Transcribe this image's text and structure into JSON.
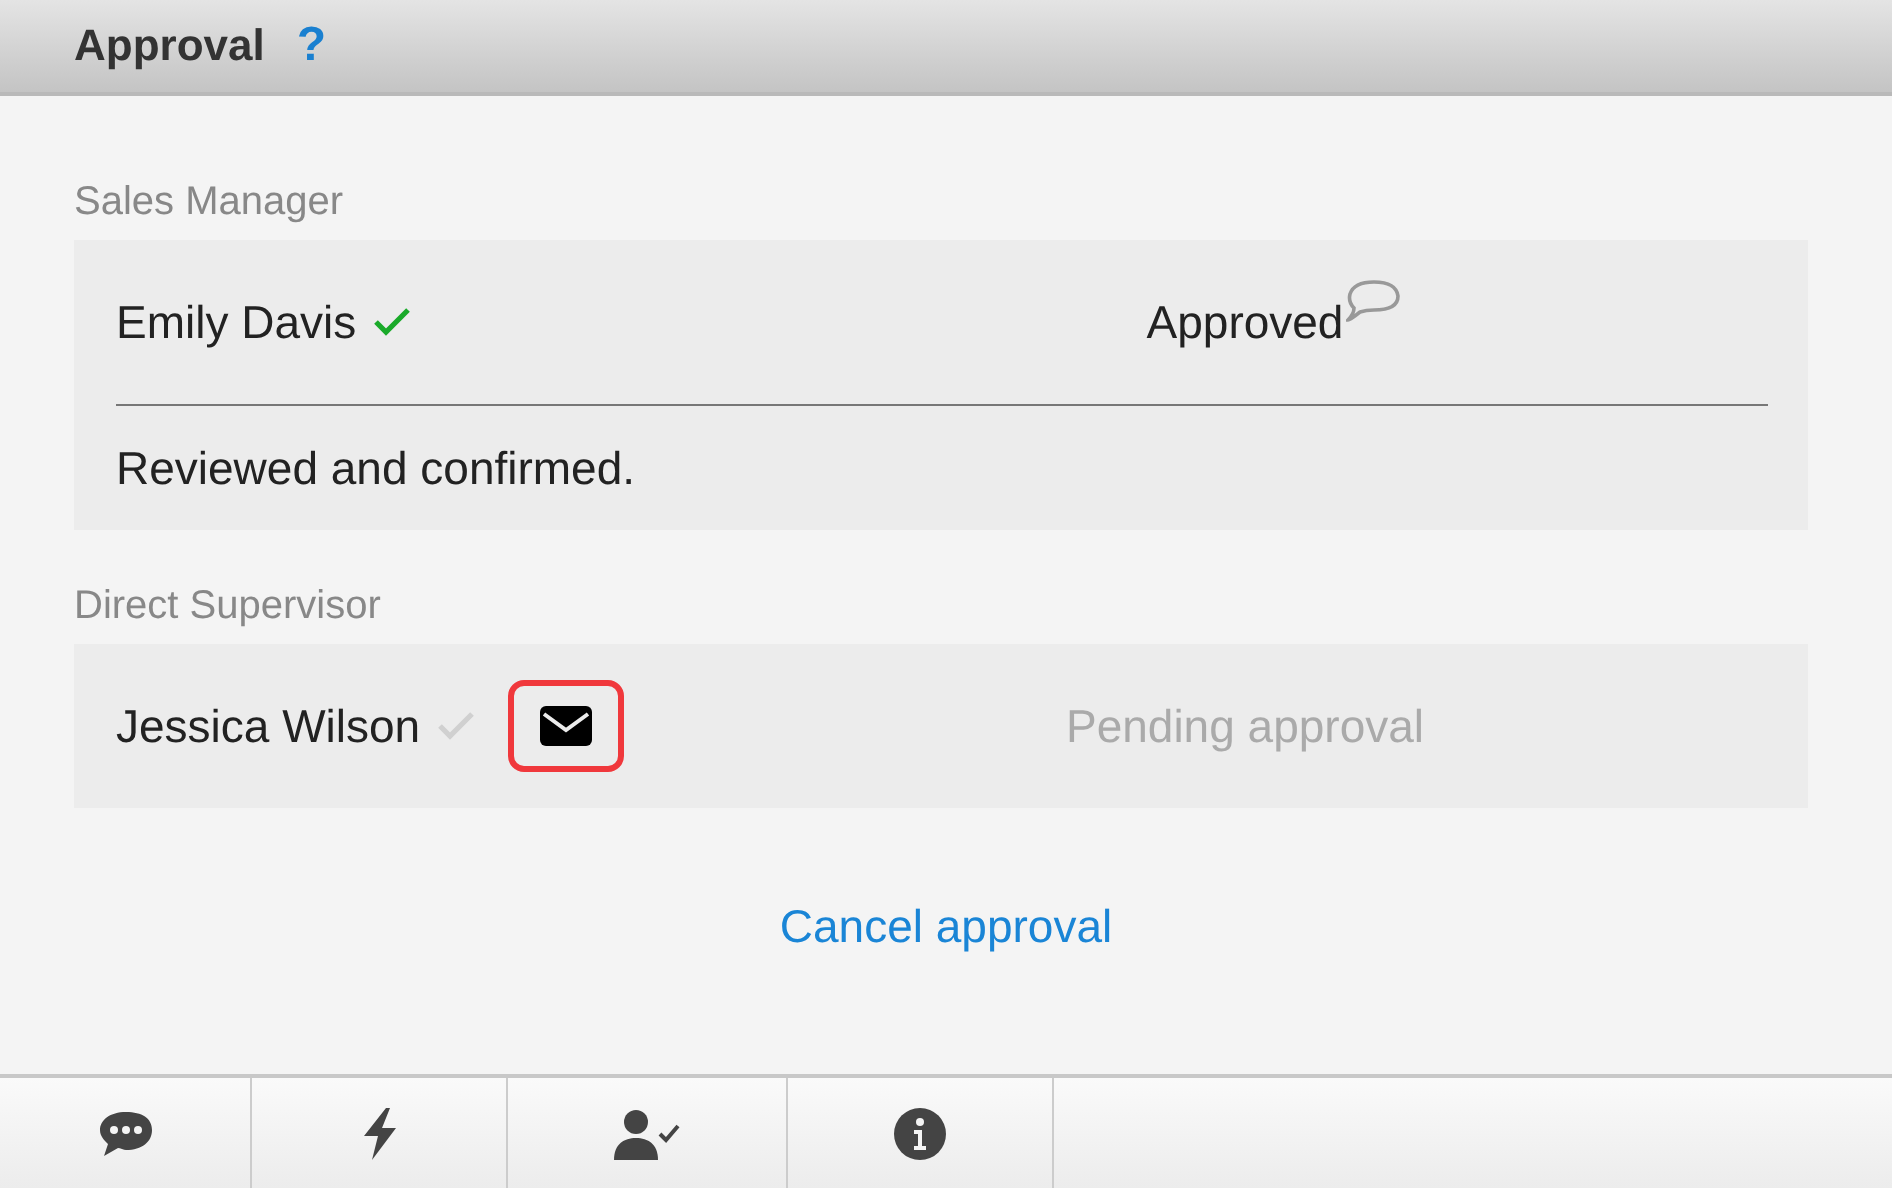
{
  "header": {
    "title": "Approval",
    "help": "?"
  },
  "steps": [
    {
      "role": "Sales Manager",
      "approver": "Emily Davis",
      "approved": true,
      "status": "Approved",
      "has_comment": true,
      "comment": "Reviewed and confirmed."
    },
    {
      "role": "Direct Supervisor",
      "approver": "Jessica Wilson",
      "approved": false,
      "status": "Pending approval",
      "reminder_button": true,
      "highlighted": true
    }
  ],
  "cancel_link": "Cancel approval",
  "toolbar": [
    {
      "kind": "comments"
    },
    {
      "kind": "actions"
    },
    {
      "kind": "approver"
    },
    {
      "kind": "info"
    }
  ]
}
